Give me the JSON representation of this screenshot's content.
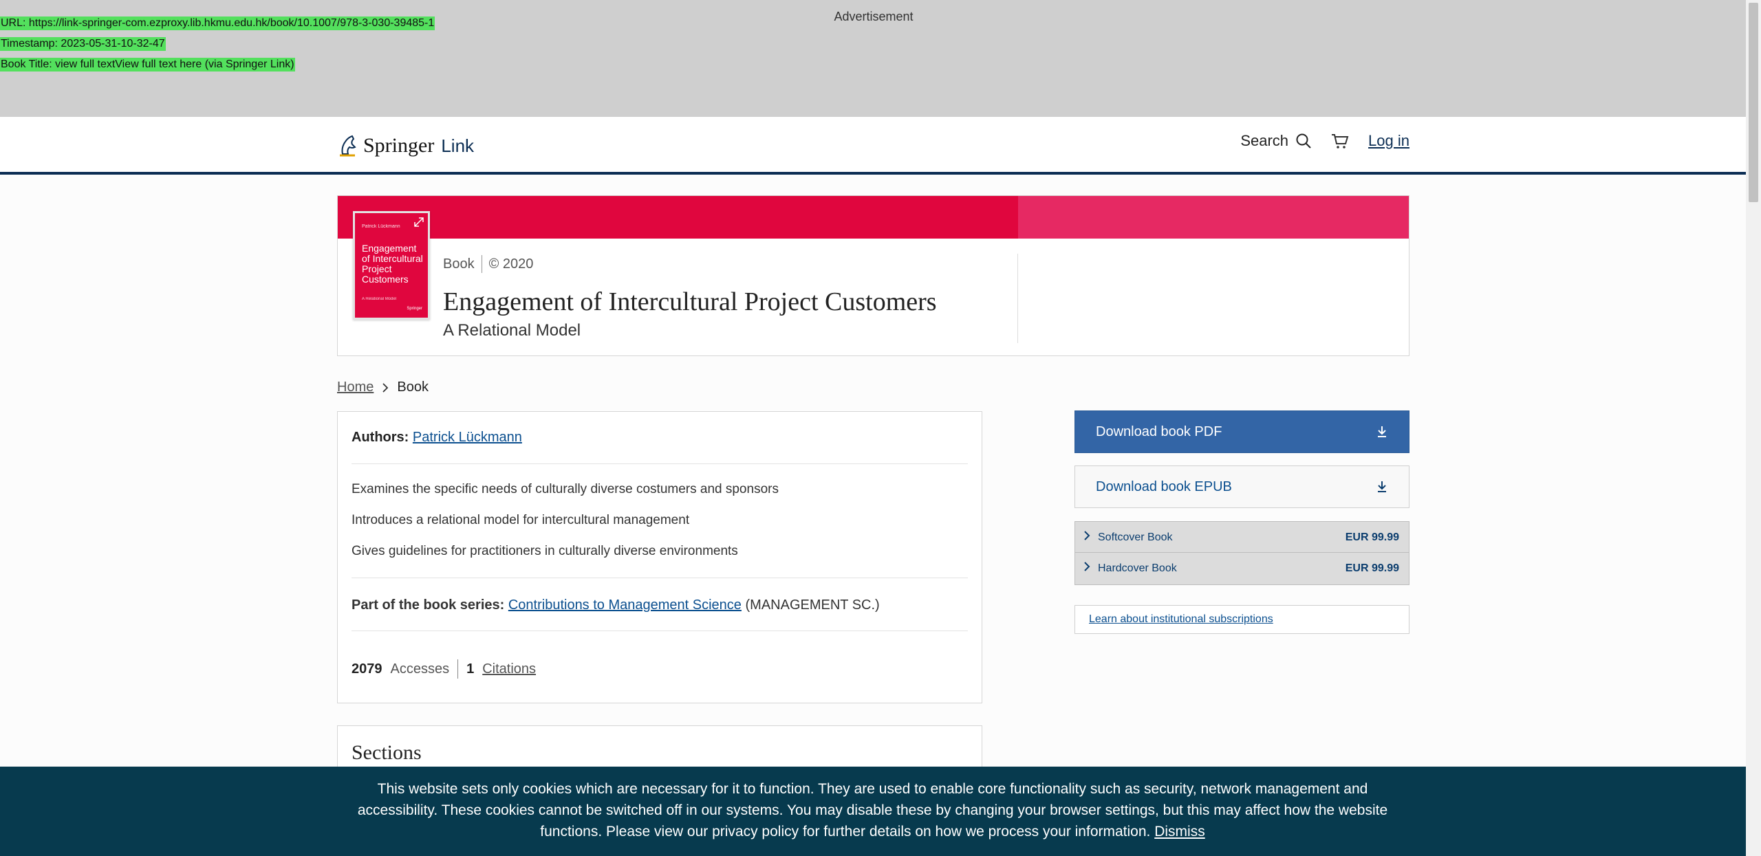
{
  "ad": {
    "label": "Advertisement"
  },
  "overlay": {
    "url": "URL: https://link-springer-com.ezproxy.lib.hkmu.edu.hk/book/10.1007/978-3-030-39485-1",
    "timestamp": "Timestamp: 2023-05-31-10-32-47",
    "book_title": "Book Title: view full textView full text here (via Springer Link)"
  },
  "header": {
    "logo_text": "Springer",
    "logo_suffix": "Link",
    "search_label": "Search",
    "login_label": "Log in"
  },
  "book": {
    "type": "Book",
    "copyright": "© 2020",
    "title": "Engagement of Intercultural Project Customers",
    "subtitle": "A Relational Model",
    "cover": {
      "author": "Patrick Lückmann",
      "title": "Engagement of Intercultural Project Customers",
      "subtitle": "A Relational Model",
      "publisher": "Springer"
    }
  },
  "breadcrumb": {
    "home": "Home",
    "current": "Book"
  },
  "info": {
    "authors_label": "Authors:",
    "author_name": "Patrick Lückmann",
    "bullets": [
      "Examines the specific needs of culturally diverse costumers and sponsors",
      "Introduces a relational model for intercultural management",
      "Gives guidelines for practitioners in culturally diverse environments"
    ],
    "series_label": "Part of the book series:",
    "series_name": "Contributions to Management Science",
    "series_abbr": "(MANAGEMENT SC.)",
    "accesses_count": "2079",
    "accesses_label": "Accesses",
    "citations_count": "1",
    "citations_label": "Citations"
  },
  "sections": {
    "title": "Sections"
  },
  "sidebar": {
    "download_pdf": "Download book PDF",
    "download_epub": "Download book EPUB",
    "prices": [
      {
        "name": "Softcover Book",
        "price": "EUR 99.99"
      },
      {
        "name": "Hardcover Book",
        "price": "EUR 99.99"
      }
    ],
    "institutional": "Learn about institutional subscriptions"
  },
  "cookie": {
    "text": "This website sets only cookies which are necessary for it to function. They are used to enable core functionality such as security, network management and accessibility. These cookies cannot be switched off in our systems. You may disable these by changing your browser settings, but this may affect how the website functions. Please view our privacy policy for further details on how we process your information.",
    "dismiss": "Dismiss"
  },
  "colors": {
    "brand_red": "#e0063e",
    "brand_pink": "#e62963",
    "navy": "#0b2d53",
    "primary_button": "#3365a6",
    "cookie_bg": "#073a4e"
  },
  "icons": [
    "springer-logo-icon",
    "search-icon",
    "cart-icon",
    "expand-icon",
    "download-icon",
    "chevron-right-icon"
  ]
}
